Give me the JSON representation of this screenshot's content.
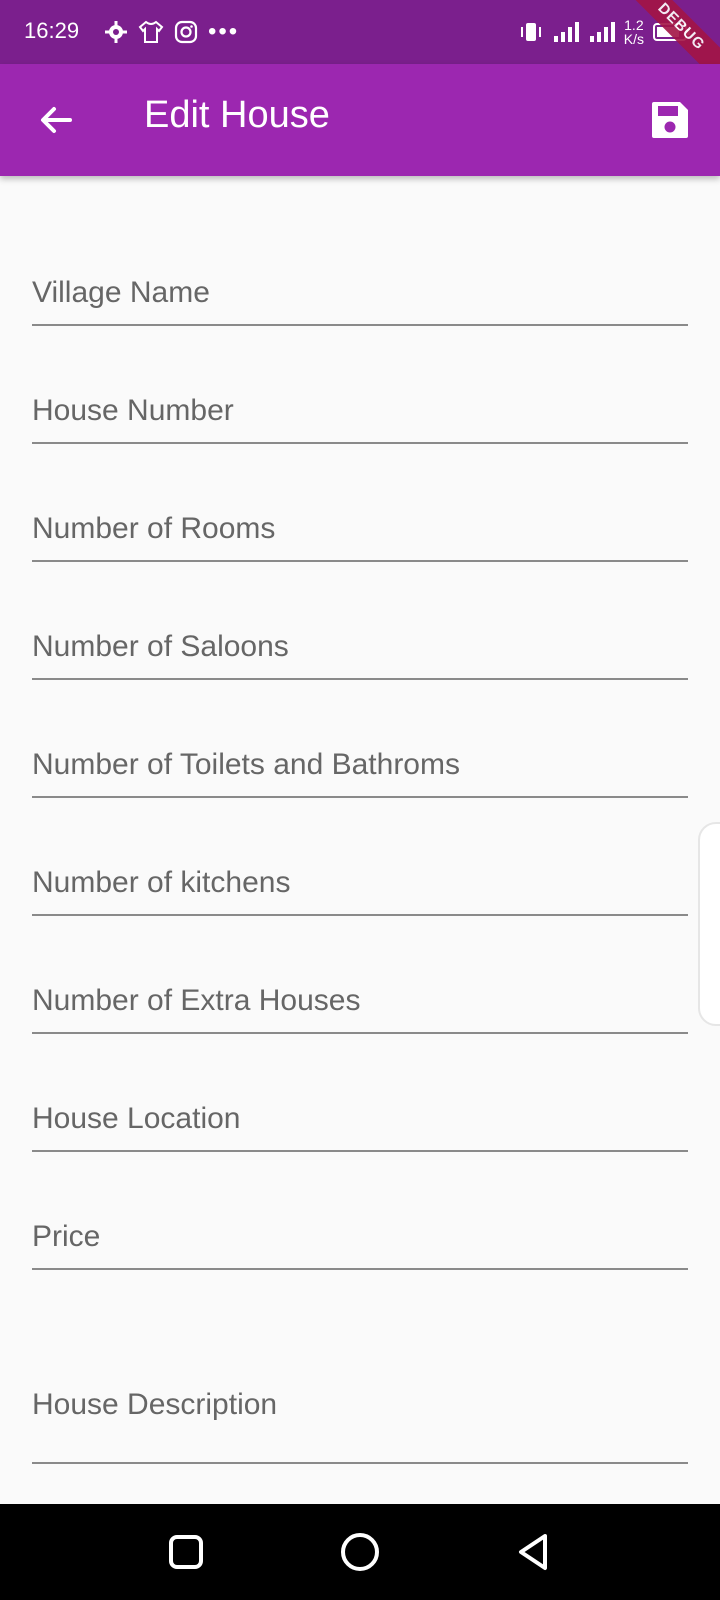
{
  "status_bar": {
    "time": "16:29",
    "net_speed_value": "1.2",
    "net_speed_unit": "K/s",
    "debug_banner": "DEBUG"
  },
  "app_bar": {
    "title": "Edit House",
    "back_icon": "arrow-left-icon",
    "save_icon": "save-icon",
    "color": "#9c27b0"
  },
  "form": {
    "fields": [
      {
        "label": "Village Name"
      },
      {
        "label": "House Number"
      },
      {
        "label": "Number of Rooms"
      },
      {
        "label": "Number of Saloons"
      },
      {
        "label": "Number of Toilets and Bathroms"
      },
      {
        "label": "Number of kitchens"
      },
      {
        "label": "Number of Extra Houses"
      },
      {
        "label": "House Location"
      },
      {
        "label": "Price"
      },
      {
        "label": "House Description"
      }
    ]
  },
  "nav_bar": {
    "recent_icon": "square-icon",
    "home_icon": "circle-icon",
    "back_icon": "triangle-back-icon"
  }
}
